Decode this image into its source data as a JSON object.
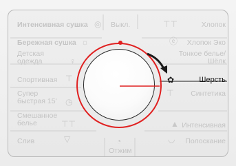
{
  "left_programs": [
    {
      "label": "Интенсивная сушка"
    },
    {
      "label": "Бережная сушка"
    },
    {
      "label": "Детская\nодежда"
    },
    {
      "label": "Спортивная"
    },
    {
      "label": "Супер\nбыстрая 15'"
    },
    {
      "label": "Смешанное\nбелье"
    },
    {
      "label": "Слив"
    }
  ],
  "right_programs": [
    {
      "label": "Хлопок"
    },
    {
      "label": "Хлопок Эко"
    },
    {
      "label": "Тонкое белье/\nШёлк"
    },
    {
      "label": "Шерсть"
    },
    {
      "label": "Синтетика"
    },
    {
      "label": "Интенсивная"
    },
    {
      "label": "Полоскание"
    }
  ],
  "top_labels": {
    "off": "Выкл."
  },
  "bottom_labels": {
    "spin": "Отжим"
  },
  "selected_program": "Шерсть",
  "colors": {
    "accent_red": "#e02020",
    "active_text": "#1b1b1b",
    "inactive_text": "#c4c4c4"
  },
  "icons": {
    "intensive_dry": "sun-icon",
    "gentle_dry": "sun-icon",
    "kids": "bottle-icon",
    "sport": "shirt-icon",
    "super_quick": "timer-icon",
    "mixed": "shirts-icon",
    "drain": "drain-icon",
    "cotton": "shirts-icon",
    "cotton_eco": "eco-icon",
    "delicate": "butterfly-icon",
    "wool": "wool-icon",
    "synthetic": "shirt-icon",
    "intensive": "iron-icon",
    "rinse": "rinse-icon",
    "spin": "spin-icon"
  }
}
